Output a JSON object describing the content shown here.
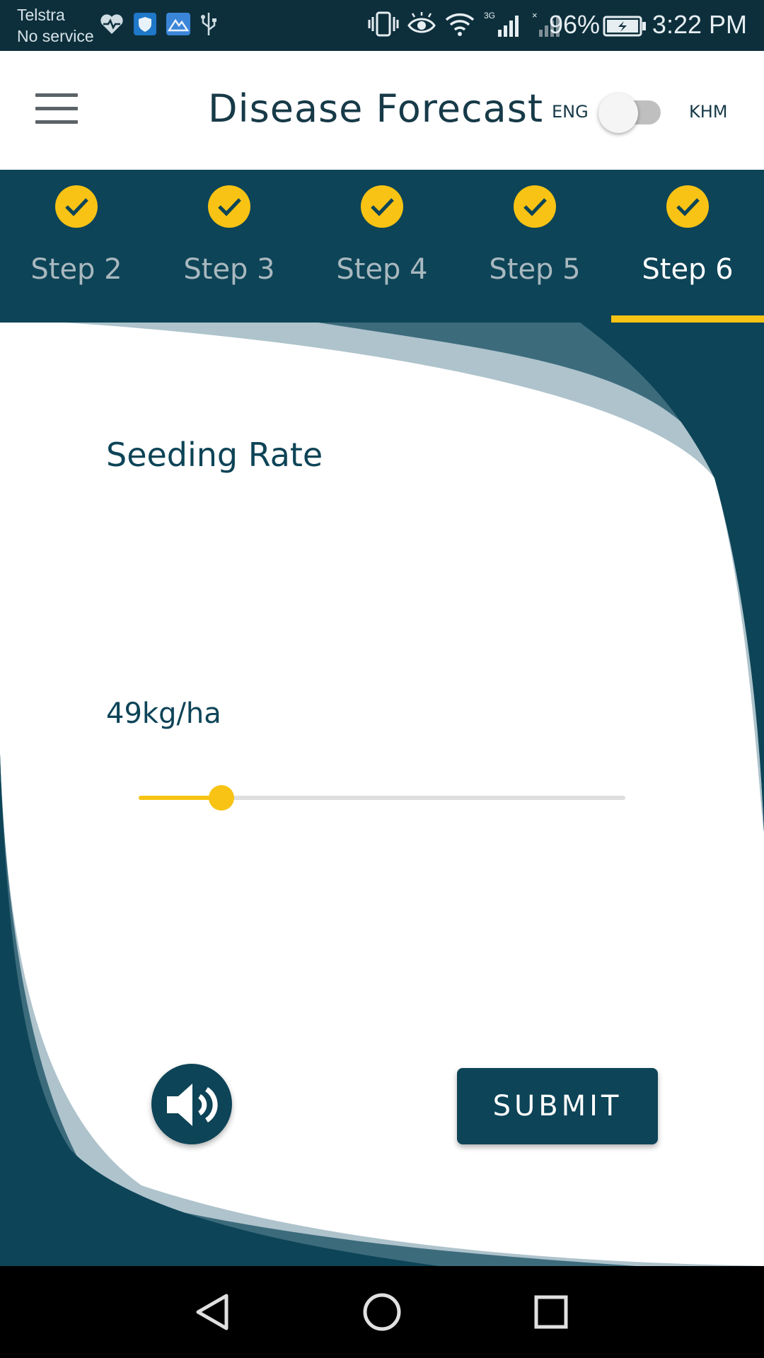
{
  "status_bar": {
    "carrier": "Telstra",
    "service": "No service",
    "network": "3G",
    "battery": "96%",
    "time": "3:22 PM",
    "icons_left": [
      "heart-rate-icon",
      "shield-app-icon",
      "mountain-app-icon",
      "usb-icon"
    ],
    "icons_right": [
      "vibrate-icon",
      "eye-icon",
      "wifi-icon",
      "signal-icon",
      "no-signal-icon",
      "battery-charging-icon"
    ]
  },
  "app_bar": {
    "title": "Disease Forecast",
    "lang_left": "ENG",
    "lang_right": "KHM",
    "toggle_state": "ENG"
  },
  "stepper": {
    "steps": [
      {
        "label": "Step 2",
        "completed": true,
        "active": false
      },
      {
        "label": "Step 3",
        "completed": true,
        "active": false
      },
      {
        "label": "Step 4",
        "completed": true,
        "active": false
      },
      {
        "label": "Step 5",
        "completed": true,
        "active": false
      },
      {
        "label": "Step 6",
        "completed": true,
        "active": true
      }
    ]
  },
  "question": {
    "title": "Seeding Rate",
    "value": "49kg/ha",
    "slider_fraction": 0.17
  },
  "actions": {
    "submit_label": "SUBMIT",
    "audio_icon": "speaker-icon"
  },
  "colors": {
    "primary": "#0d4457",
    "accent": "#f8c314",
    "status_bar": "#0d2f3c"
  }
}
